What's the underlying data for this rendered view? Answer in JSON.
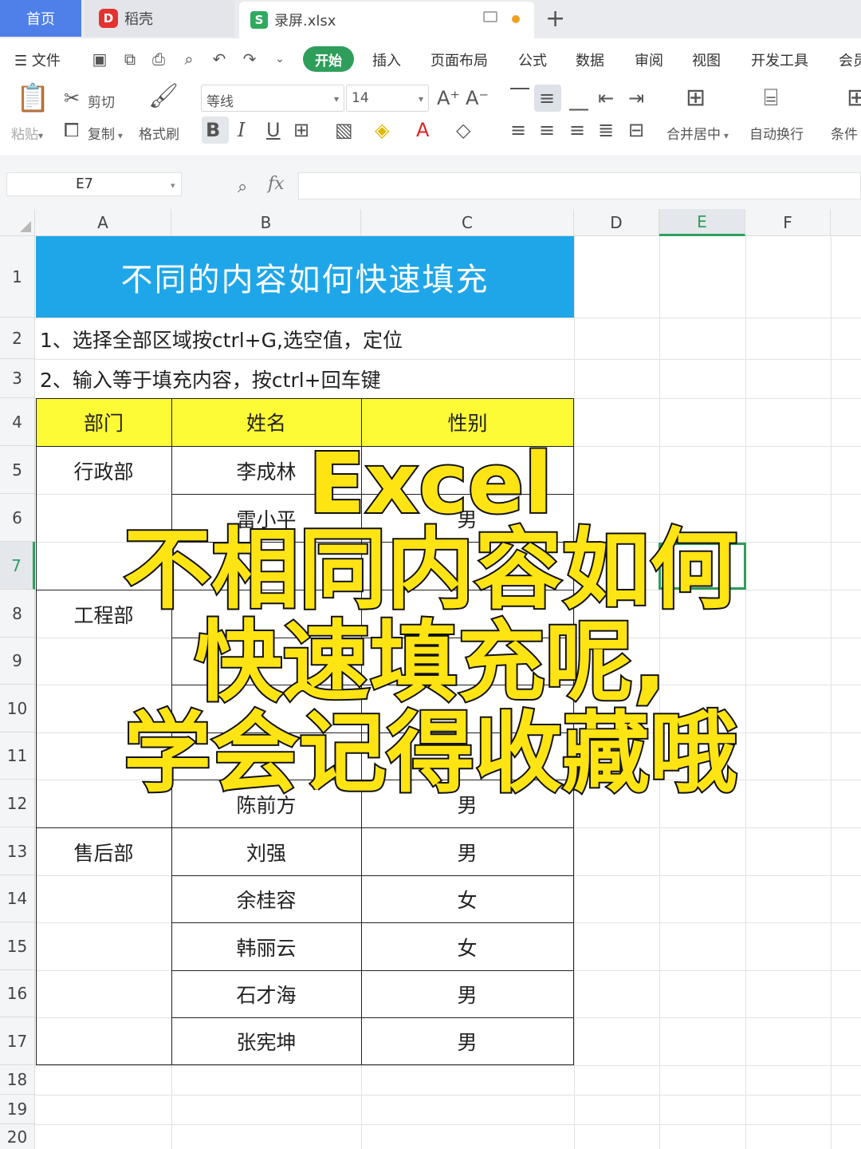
{
  "tabs": {
    "home": "首页",
    "daoke": "稻壳",
    "file": "录屏.xlsx"
  },
  "menu": {
    "file": "文件",
    "active": "开始",
    "items": [
      "插入",
      "页面布局",
      "公式",
      "数据",
      "审阅",
      "视图",
      "开发工具",
      "会员"
    ]
  },
  "ribbon": {
    "paste": "粘贴",
    "cut": "剪切",
    "copy": "复制",
    "format_painter": "格式刷",
    "font_name": "等线",
    "font_size": "14",
    "merge_center": "合并居中",
    "wrap_text": "自动换行",
    "conditional": "条件"
  },
  "formula_bar": {
    "cell_ref": "E7",
    "fx": "fx",
    "formula": ""
  },
  "columns": [
    "A",
    "B",
    "C",
    "D",
    "E",
    "F"
  ],
  "rows": [
    "1",
    "2",
    "3",
    "4",
    "5",
    "6",
    "7",
    "8",
    "9",
    "10",
    "11",
    "12",
    "13",
    "14",
    "15",
    "16",
    "17",
    "18",
    "19",
    "20"
  ],
  "sheet": {
    "title": "不同的内容如何快速填充",
    "note1": "1、选择全部区域按ctrl+G,选空值，定位",
    "note2": "2、输入等于填充内容，按ctrl+回车键",
    "headers": [
      "部门",
      "姓名",
      "性别"
    ],
    "departments": {
      "r5": "行政部",
      "r8": "工程部",
      "r13": "售后部"
    },
    "names": {
      "r5": "李成林",
      "r6": "雷小平",
      "r12": "陈前方",
      "r13": "刘强",
      "r14": "余桂容",
      "r15": "韩丽云",
      "r16": "石才海",
      "r17": "张宪坤"
    },
    "genders": {
      "r6": "男",
      "r12": "男",
      "r13": "男",
      "r14": "女",
      "r15": "女",
      "r16": "男",
      "r17": "男"
    }
  },
  "overlay": {
    "line1": "Excel",
    "line2": "不相同内容如何",
    "line3": "快速填充呢,",
    "line4": "学会记得收藏哦"
  },
  "colors": {
    "title_bg": "#1fa6e8",
    "header_bg": "#fdfa36",
    "accent": "#2f9e5b",
    "overlay_text": "#ffe414"
  }
}
